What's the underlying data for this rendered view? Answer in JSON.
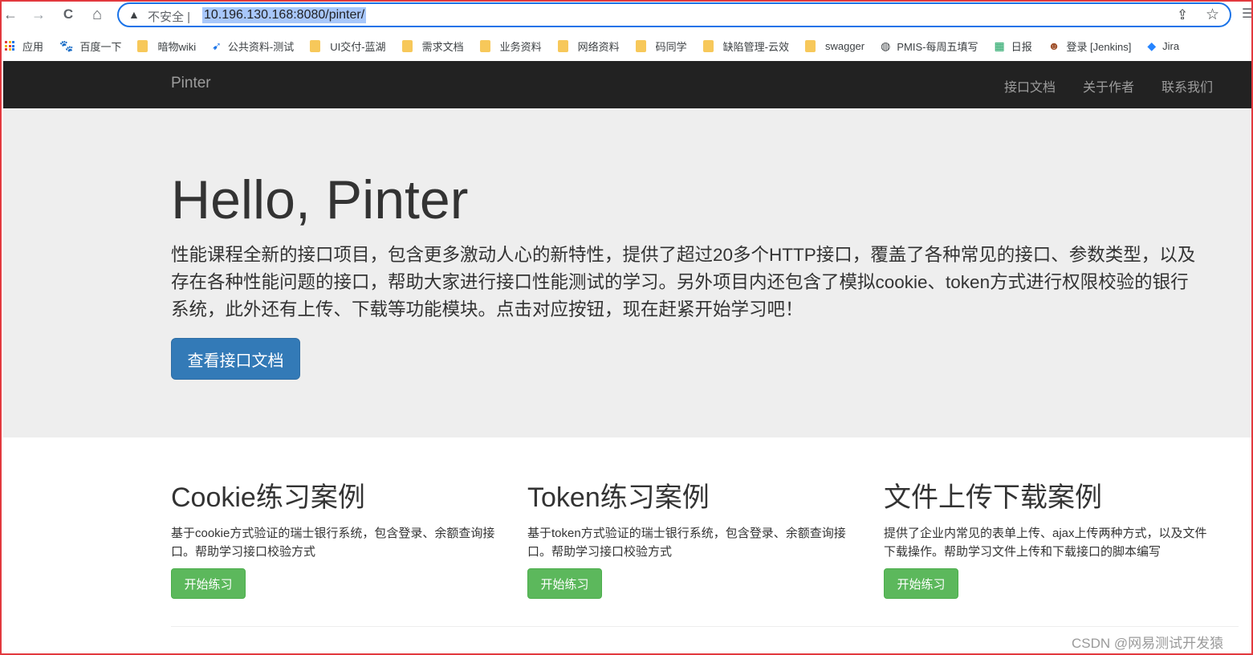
{
  "browser": {
    "insecure_label": "不安全 |",
    "url": "10.196.130.168:8080/pinter/",
    "icons": {
      "back": "←",
      "forward": "→",
      "reload": "C",
      "home": "⌂",
      "warning": "▲",
      "share": "⇪",
      "star": "☆",
      "menu": "☰"
    }
  },
  "bookmarks": [
    {
      "label": "应用",
      "icon": "apps"
    },
    {
      "label": "百度一下",
      "icon": "paw"
    },
    {
      "label": "暗物wiki",
      "icon": "folder"
    },
    {
      "label": "公共资料-测试",
      "icon": "feather"
    },
    {
      "label": "UI交付-蓝湖",
      "icon": "folder"
    },
    {
      "label": "需求文档",
      "icon": "folder"
    },
    {
      "label": "业务资料",
      "icon": "folder"
    },
    {
      "label": "网络资料",
      "icon": "folder"
    },
    {
      "label": "码同学",
      "icon": "folder"
    },
    {
      "label": "缺陷管理-云效",
      "icon": "folder"
    },
    {
      "label": "swagger",
      "icon": "folder"
    },
    {
      "label": "PMIS-每周五填写",
      "icon": "globe"
    },
    {
      "label": "日报",
      "icon": "sheet"
    },
    {
      "label": "登录 [Jenkins]",
      "icon": "jenkins"
    },
    {
      "label": "Jira",
      "icon": "jira"
    }
  ],
  "navbar": {
    "brand": "Pinter",
    "links": [
      "接口文档",
      "关于作者",
      "联系我们"
    ]
  },
  "hero": {
    "title": "Hello, Pinter",
    "description": "性能课程全新的接口项目，包含更多激动人心的新特性，提供了超过20多个HTTP接口，覆盖了各种常见的接口、参数类型，以及存在各种性能问题的接口，帮助大家进行接口性能测试的学习。另外项目内还包含了模拟cookie、token方式进行权限校验的银行系统，此外还有上传、下载等功能模块。点击对应按钮，现在赶紧开始学习吧！",
    "button": "查看接口文档"
  },
  "features": [
    {
      "title": "Cookie练习案例",
      "description": "基于cookie方式验证的瑞士银行系统，包含登录、余额查询接口。帮助学习接口校验方式",
      "button": "开始练习"
    },
    {
      "title": "Token练习案例",
      "description": "基于token方式验证的瑞士银行系统，包含登录、余额查询接口。帮助学习接口校验方式",
      "button": "开始练习"
    },
    {
      "title": "文件上传下载案例",
      "description": "提供了企业内常见的表单上传、ajax上传两种方式，以及文件下载操作。帮助学习文件上传和下载接口的脚本编写",
      "button": "开始练习"
    }
  ],
  "watermark": "CSDN @网易测试开发猿",
  "colors": {
    "navbar_bg": "#222222",
    "jumbotron_bg": "#eeeeee",
    "primary": "#337ab7",
    "success": "#5cb85c",
    "frame": "#e2393e"
  }
}
